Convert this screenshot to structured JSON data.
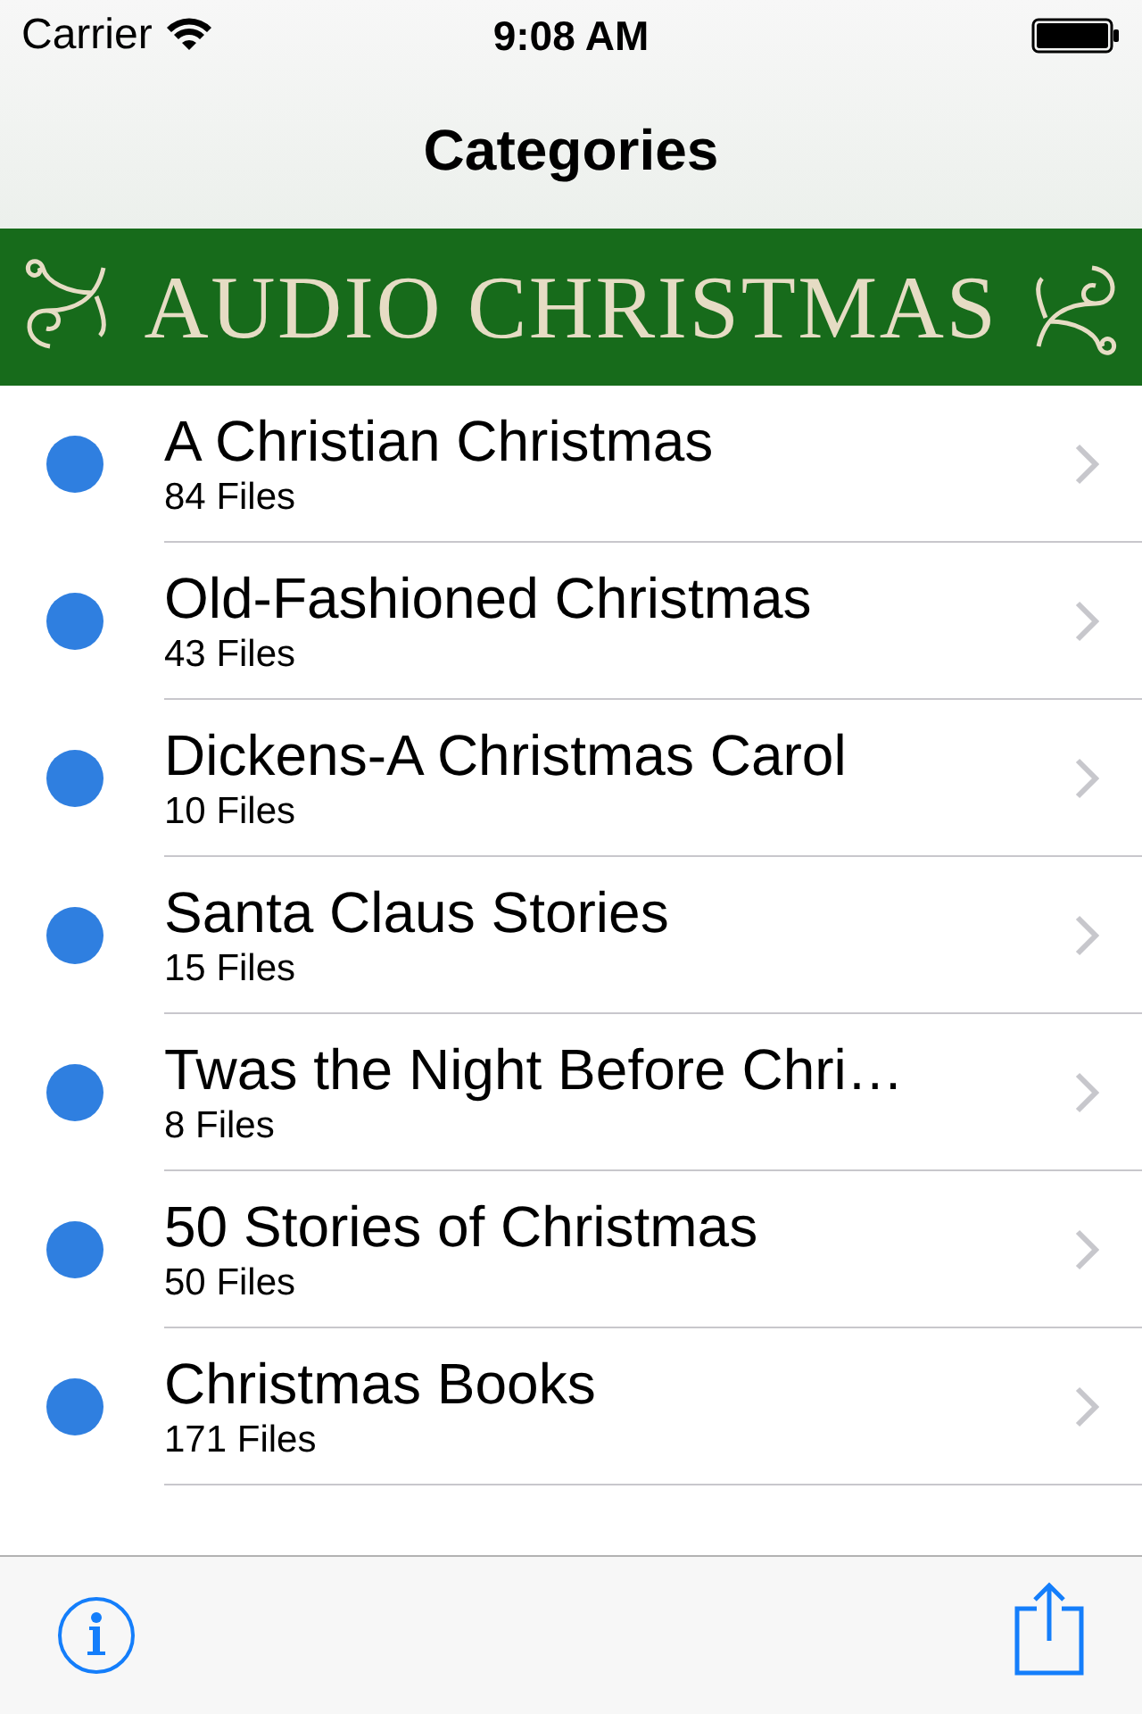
{
  "status_bar": {
    "carrier": "Carrier",
    "time": "9:08 AM"
  },
  "nav": {
    "title": "Categories"
  },
  "banner": {
    "title": "AUDIO CHRISTMAS"
  },
  "categories": [
    {
      "title": "A Christian Christmas",
      "subtitle": "84 Files"
    },
    {
      "title": "Old-Fashioned Christmas",
      "subtitle": "43 Files"
    },
    {
      "title": "Dickens-A Christmas Carol",
      "subtitle": "10 Files"
    },
    {
      "title": "Santa Claus Stories",
      "subtitle": "15 Files"
    },
    {
      "title": "Twas the Night Before Chri…",
      "subtitle": "8 Files"
    },
    {
      "title": "50 Stories of Christmas",
      "subtitle": "50 Files"
    },
    {
      "title": "Christmas Books",
      "subtitle": "171 Files"
    }
  ]
}
